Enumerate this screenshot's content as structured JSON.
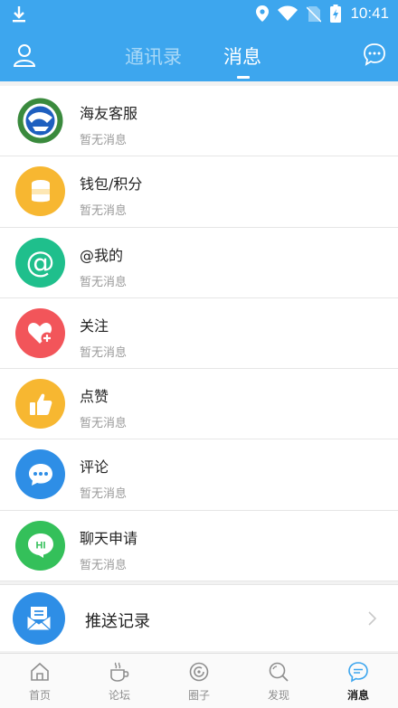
{
  "status_bar": {
    "time": "10:41"
  },
  "header": {
    "tabs": [
      "通讯录",
      "消息"
    ],
    "active_tab": "消息"
  },
  "messages": [
    {
      "title": "海友客服",
      "subtitle": "暂无消息",
      "icon": "logo",
      "color": "#2a7a3a"
    },
    {
      "title": "钱包/积分",
      "subtitle": "暂无消息",
      "icon": "wallet-coins-icon",
      "color": "#f7b731"
    },
    {
      "title": "@我的",
      "subtitle": "暂无消息",
      "icon": "at-icon",
      "color": "#1fbf8c"
    },
    {
      "title": "关注",
      "subtitle": "暂无消息",
      "icon": "heart-plus-icon",
      "color": "#f2555a"
    },
    {
      "title": "点赞",
      "subtitle": "暂无消息",
      "icon": "thumbs-up-icon",
      "color": "#f7b731"
    },
    {
      "title": "评论",
      "subtitle": "暂无消息",
      "icon": "comment-icon",
      "color": "#2e8ee6"
    },
    {
      "title": "聊天申请",
      "subtitle": "暂无消息",
      "icon": "hi-bubble-icon",
      "color": "#34c05a"
    }
  ],
  "push": {
    "title": "推送记录",
    "icon": "push-record-icon"
  },
  "tabbar": [
    {
      "label": "首页",
      "icon": "home-icon"
    },
    {
      "label": "论坛",
      "icon": "cup-icon"
    },
    {
      "label": "圈子",
      "icon": "circle-icon"
    },
    {
      "label": "发现",
      "icon": "search-icon"
    },
    {
      "label": "消息",
      "icon": "message-icon",
      "active": true
    }
  ],
  "colors": {
    "primary": "#3da6ee",
    "row_bg": "#ffffff",
    "subtitle": "#9a9a9a"
  }
}
